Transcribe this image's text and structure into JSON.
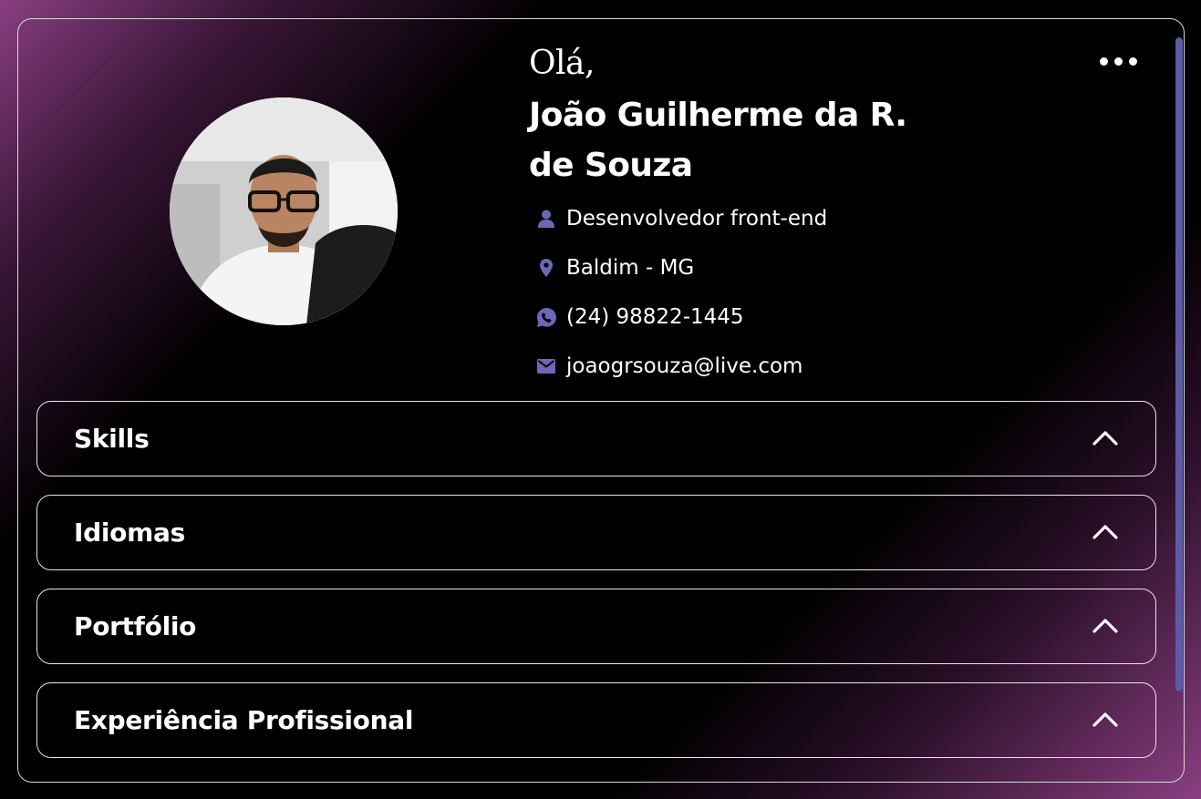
{
  "profile": {
    "greeting": "Olá,",
    "name": "João Guilherme da R. de Souza",
    "role": "Desenvolvedor front-end",
    "location": "Baldim - MG",
    "phone": "(24) 98822-1445",
    "email": "joaogrsouza@live.com"
  },
  "icons": {
    "role": "person-icon",
    "location": "map-pin-icon",
    "phone": "whatsapp-icon",
    "email": "envelope-icon",
    "menu": "more-dots-icon",
    "section": "chevron-up-icon"
  },
  "sections": [
    {
      "title": "Skills"
    },
    {
      "title": "Idiomas"
    },
    {
      "title": "Portfólio"
    },
    {
      "title": "Experiência Profissional"
    }
  ],
  "colors": {
    "accent": "#6c68b5",
    "gradient_edge": "#8a3f82",
    "background": "#000000"
  }
}
